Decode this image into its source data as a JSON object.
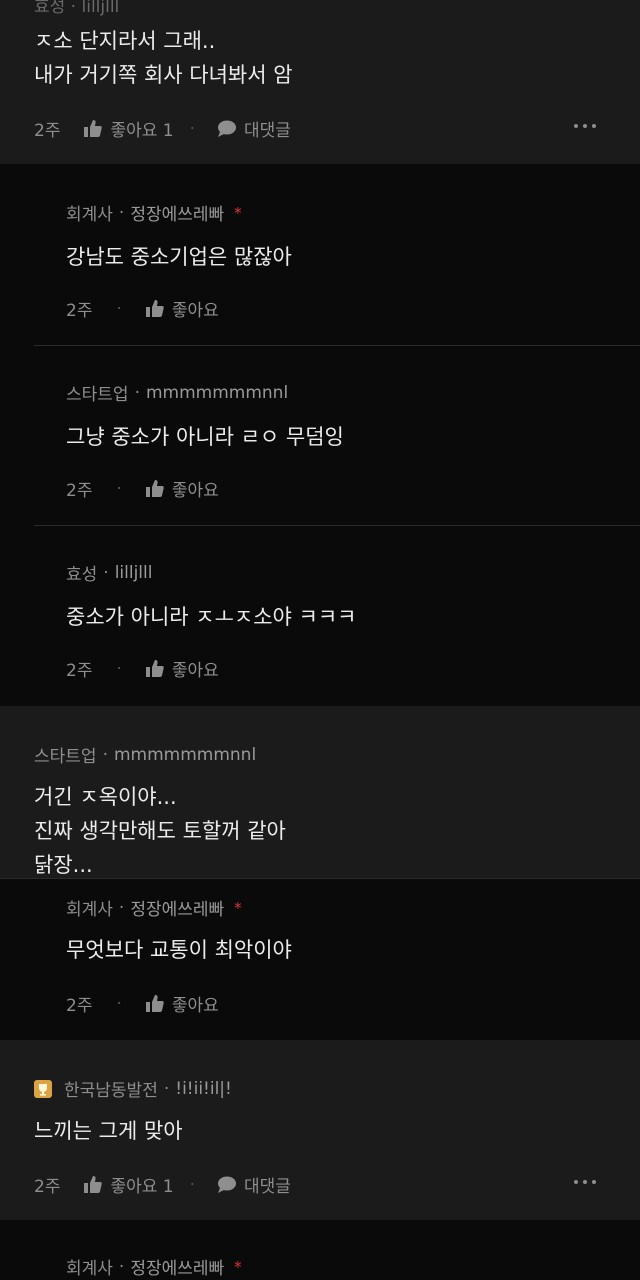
{
  "top_cut": {
    "company": "효성",
    "nick": "lilljlll"
  },
  "c1": {
    "lines": [
      "ㅈ소 단지라서 그래..",
      "내가 거기쪽 회사 다녀봐서 암"
    ],
    "time": "2주",
    "like": "좋아요 1",
    "reply": "대댓글"
  },
  "r1": {
    "company": "회계사",
    "nick": "정장에쓰레빠",
    "star": "*",
    "text": "강남도 중소기업은 많잖아",
    "time": "2주",
    "like": "좋아요"
  },
  "r2": {
    "company": "스타트업",
    "nick": "mmmmmmmnnl",
    "text": "그냥 중소가 아니라 ㄹㅇ 무덤잉",
    "time": "2주",
    "like": "좋아요"
  },
  "r3": {
    "company": "효성",
    "nick": "lilljlll",
    "text": "중소가 아니라 ㅈㅗㅈ소야 ㅋㅋㅋ",
    "time": "2주",
    "like": "좋아요"
  },
  "c2": {
    "company": "스타트업",
    "nick": "mmmmmmmnnl",
    "lines": [
      "거긴 ㅈ옥이야...",
      "진짜 생각만해도 토할꺼 같아",
      "닭장..."
    ]
  },
  "r4": {
    "company": "회계사",
    "nick": "정장에쓰레빠",
    "star": "*",
    "text": "무엇보다 교통이 최악이야",
    "time": "2주",
    "like": "좋아요"
  },
  "c3": {
    "company": "한국남동발전",
    "nick": "!i!ii!il|!",
    "text": "느끼는 그게 맞아",
    "time": "2주",
    "like": "좋아요 1",
    "reply": "대댓글",
    "badge_color": "#d9a441"
  },
  "r5": {
    "company": "회계사",
    "nick": "정장에쓰레빠",
    "star": "*"
  }
}
